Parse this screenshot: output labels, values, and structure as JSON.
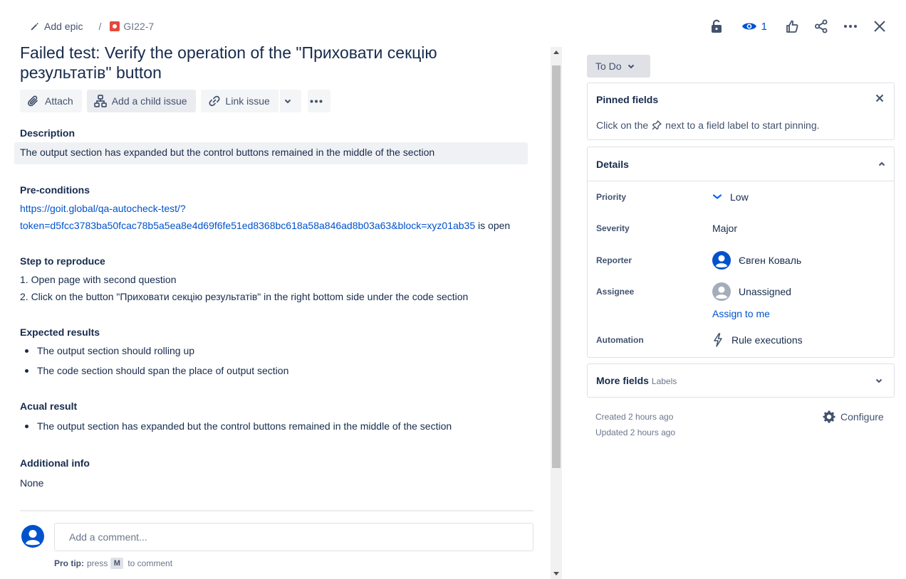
{
  "breadcrumb": {
    "add_epic": "Add epic",
    "separator": "/",
    "issue_key": "GI22-7"
  },
  "header_actions": {
    "watch_count": "1"
  },
  "issue": {
    "title": "Failed test: Verify the operation of the \"Приховати секцію результатів\" button"
  },
  "toolbar": {
    "attach": "Attach",
    "add_child": "Add a child issue",
    "link_issue": "Link issue"
  },
  "description": {
    "heading": "Description",
    "text": "The output section has expanded but the control buttons remained in the middle of the section"
  },
  "preconditions": {
    "heading": "Pre-conditions",
    "link_line1": "https://goit.global/qa-autocheck-test/?",
    "link_line2": "token=d5fcc3783ba50fcac78b5a5ea8e4d69f6fe51ed8368bc618a58a846ad8b03a63&block=xyz01ab35",
    "suffix": " is open"
  },
  "steps": {
    "heading": "Step to reproduce",
    "items": [
      "1. Open page with second question",
      "2. Click on the button \"Приховати секцію результатів\" in the right bottom side under the code section"
    ]
  },
  "expected": {
    "heading": "Expected results",
    "items": [
      "The output section should rolling up",
      "The code section should span the place of output section"
    ]
  },
  "actual": {
    "heading": "Acual result",
    "items": [
      "The output section has expanded but the control buttons remained in the middle of the section"
    ]
  },
  "additional": {
    "heading": "Additional info",
    "text": "None"
  },
  "comment": {
    "placeholder": "Add a comment...",
    "protip_label": "Pro tip:",
    "protip_press": "press",
    "protip_key": "M",
    "protip_suffix": "to comment"
  },
  "status": {
    "label": "To Do"
  },
  "pinned": {
    "heading": "Pinned fields",
    "hint_before": "Click on the",
    "hint_after": "next to a field label to start pinning."
  },
  "details": {
    "heading": "Details",
    "priority_label": "Priority",
    "priority_value": "Low",
    "severity_label": "Severity",
    "severity_value": "Major",
    "reporter_label": "Reporter",
    "reporter_value": "Євген Коваль",
    "assignee_label": "Assignee",
    "assignee_value": "Unassigned",
    "assign_to_me": "Assign to me",
    "automation_label": "Automation",
    "automation_value": "Rule executions"
  },
  "more_fields": {
    "heading": "More fields",
    "sub": "Labels"
  },
  "meta": {
    "created": "Created 2 hours ago",
    "updated": "Updated 2 hours ago",
    "configure": "Configure"
  },
  "colors": {
    "primary_text": "#172b4d",
    "link": "#0052cc",
    "bug": "#e5493a"
  }
}
